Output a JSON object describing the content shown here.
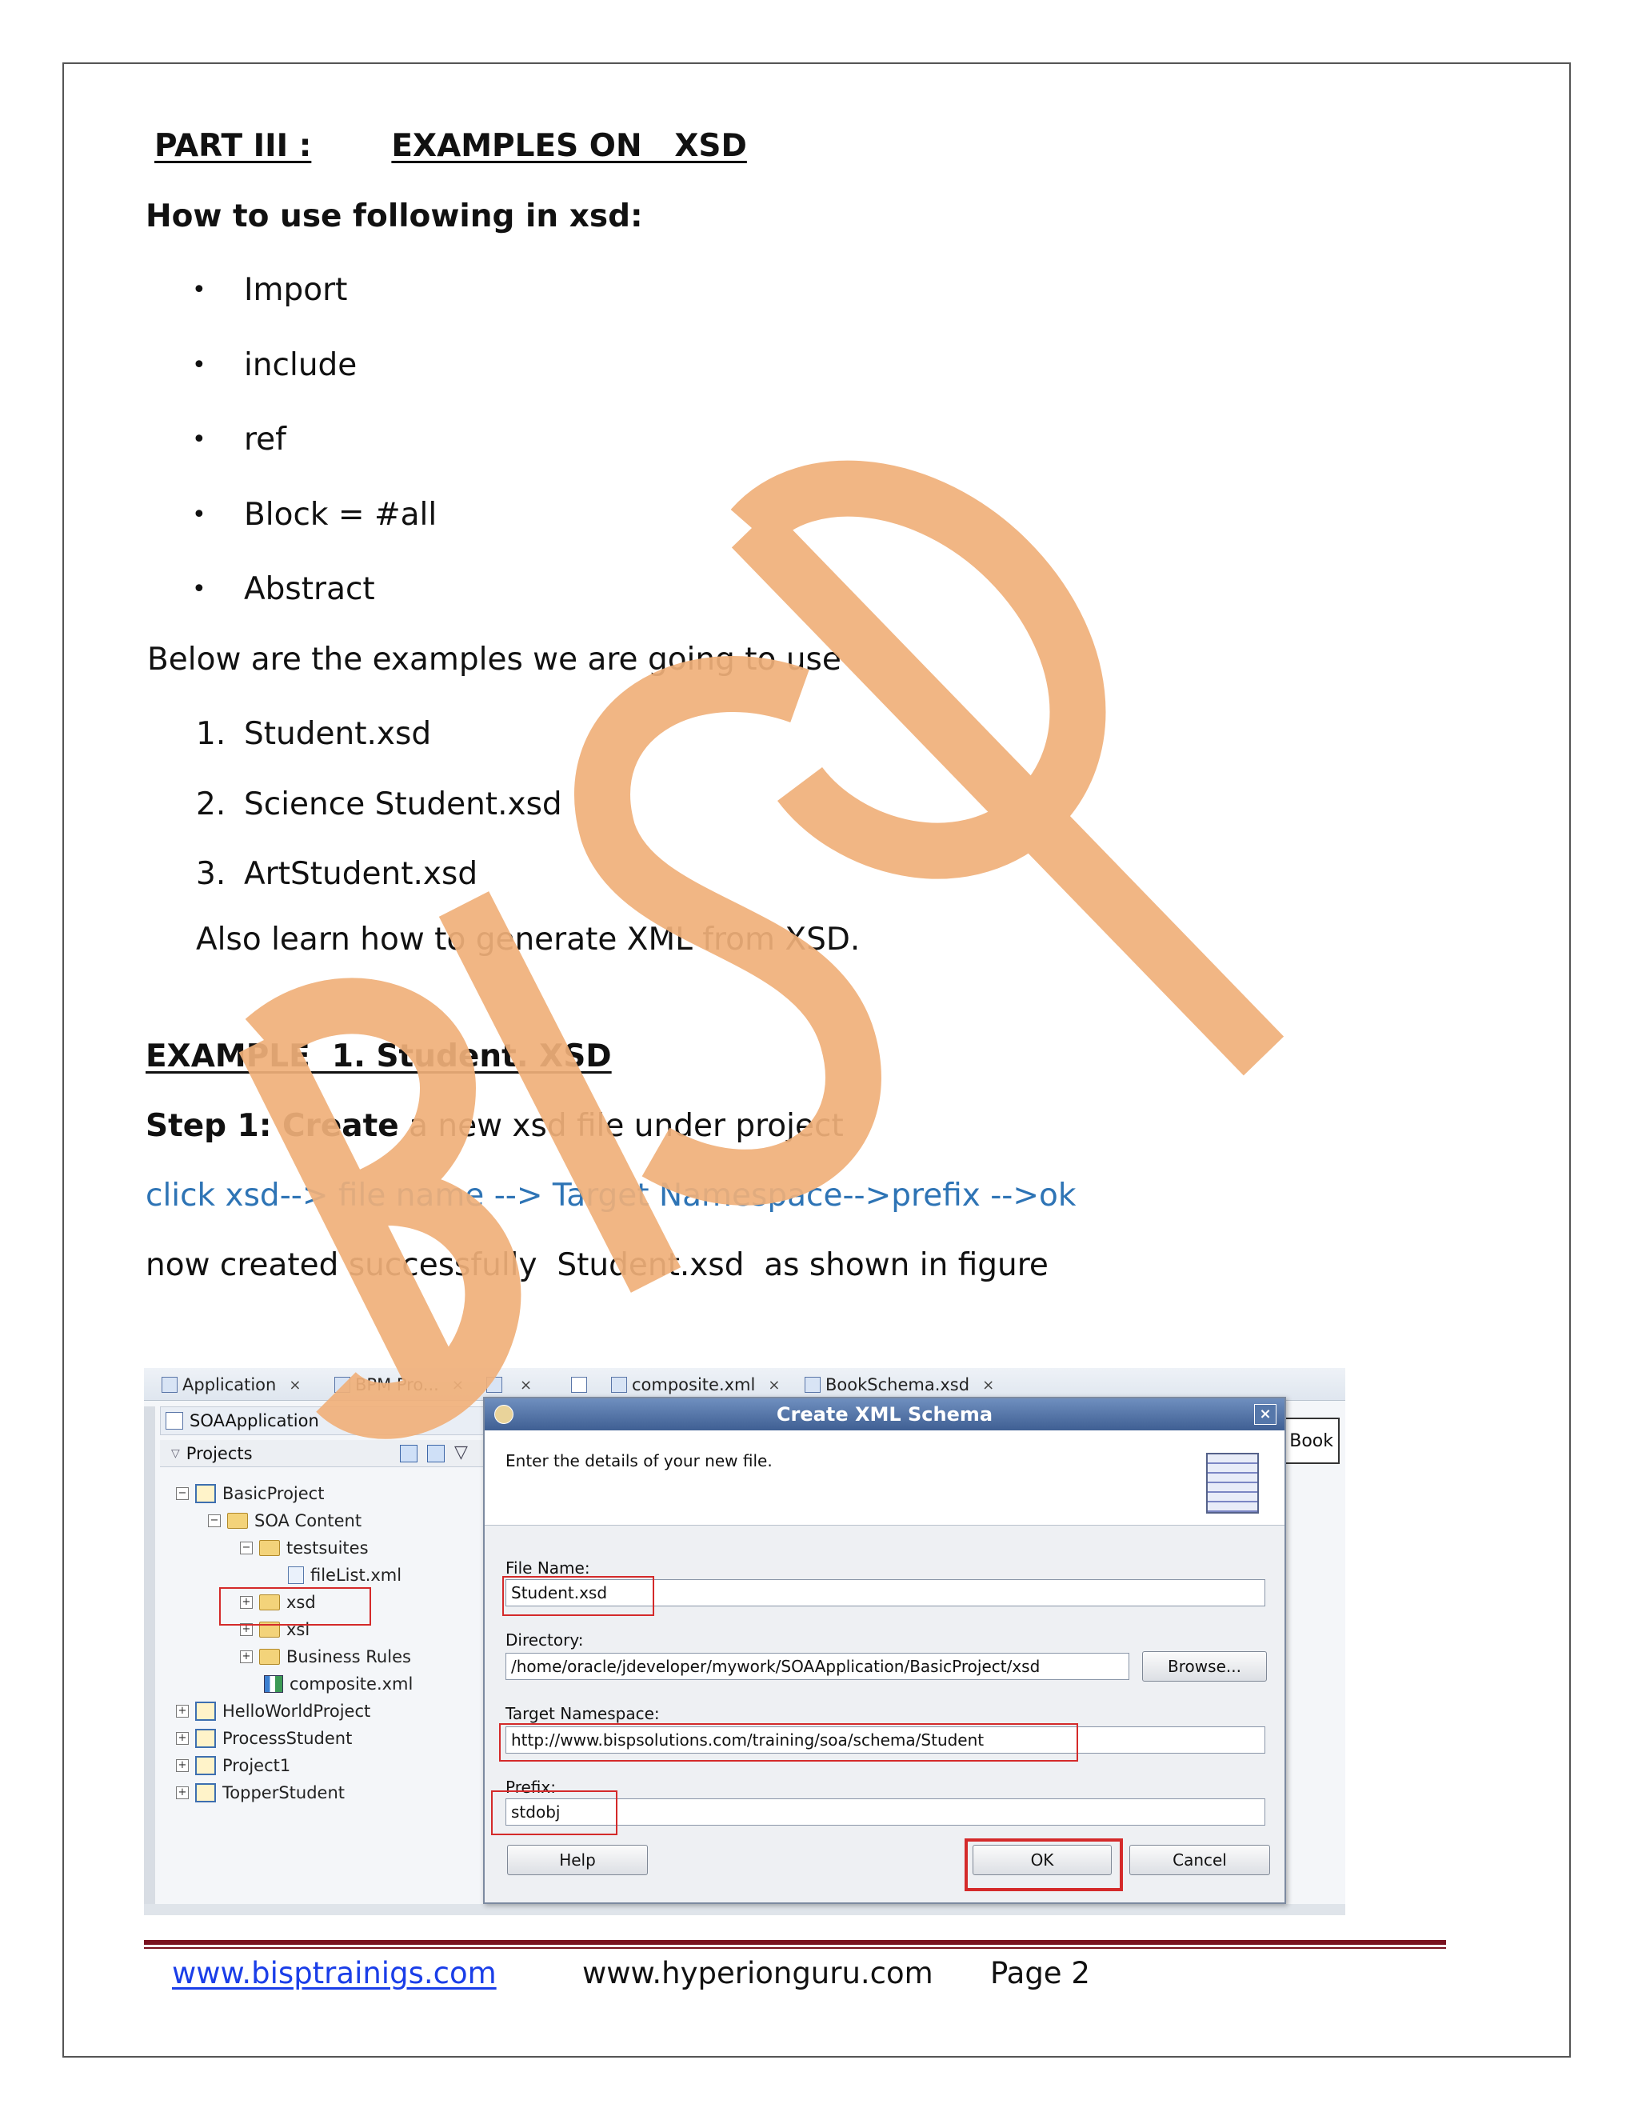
{
  "part": {
    "label": "PART III :",
    "title": "EXAMPLES ON   XSD"
  },
  "intro_question": "How to use following in xsd:",
  "topics": [
    "Import",
    "include",
    "ref",
    "Block = #all",
    "Abstract"
  ],
  "examples_intro": "Below are the examples we are going to use",
  "examples": [
    {
      "num": "1.",
      "label": "Student.xsd"
    },
    {
      "num": "2.",
      "label": "Science Student.xsd"
    },
    {
      "num": "3.",
      "label": "ArtStudent.xsd"
    }
  ],
  "also_learn": "Also learn how to generate XML from XSD.",
  "example_heading": "EXAMPLE  1. Student. XSD",
  "step1": {
    "bold": "Step 1: Create",
    "rest": " a new xsd file under project"
  },
  "instruction": "click xsd--> file name --> Target Namespace-->prefix -->ok",
  "created_text": "now created successfully  Student.xsd  as shown in figure",
  "screenshot": {
    "tabs": [
      {
        "label": "Application"
      },
      {
        "label": "BPM Pro..."
      },
      {
        "label": ""
      },
      {
        "label": ""
      },
      {
        "label": "composite.xml"
      },
      {
        "label": "BookSchema.xsd"
      }
    ],
    "app_name": "SOAApplication",
    "projects_label": "Projects",
    "tree": {
      "basic_project": "BasicProject",
      "soa_content": "SOA Content",
      "testsuites": "testsuites",
      "filelist": "fileList.xml",
      "xsd": "xsd",
      "xsl": "xsl",
      "business_rules": "Business Rules",
      "composite": "composite.xml",
      "hello_world": "HelloWorldProject",
      "process_student": "ProcessStudent",
      "project1": "Project1",
      "topper_student": "TopperStudent"
    },
    "book_label": "Book",
    "dialog": {
      "title": "Create XML Schema",
      "message": "Enter the details of your new file.",
      "file_name_label": "File Name:",
      "file_name": "Student.xsd",
      "directory_label": "Directory:",
      "directory": "/home/oracle/jdeveloper/mywork/SOAApplication/BasicProject/xsd",
      "browse": "Browse...",
      "target_ns_label": "Target Namespace:",
      "target_ns": "http://www.bispsolutions.com/training/soa/schema/Student",
      "prefix_label": "Prefix:",
      "prefix": "stdobj",
      "help": "Help",
      "ok": "OK",
      "cancel": "Cancel"
    }
  },
  "watermark": "BISP",
  "footer": {
    "link": "www.bisptrainigs.com",
    "site": "www.hyperionguru.com",
    "page": "Page 2"
  },
  "colors": {
    "instruction": "#2e74b5",
    "watermark": "#f0b07a",
    "footer_rule": "#7a1220",
    "highlight_box": "#d42a2a"
  }
}
